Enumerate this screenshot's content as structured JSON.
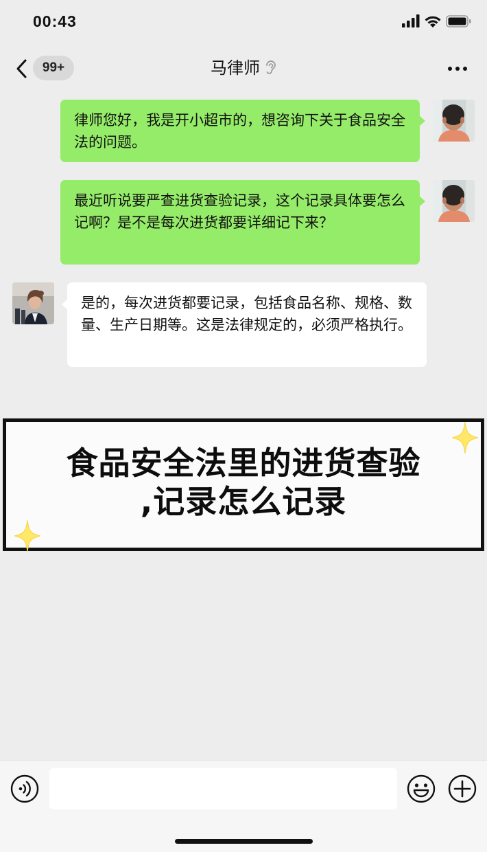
{
  "status_bar": {
    "time": "00:43",
    "icons": [
      "cellular-signal-icon",
      "wifi-icon",
      "battery-icon"
    ]
  },
  "nav": {
    "back_icon": "chevron-left-icon",
    "unread_badge": "99+",
    "title": "马律师",
    "title_icon": "ear-icon",
    "more_icon": "more-dots-icon"
  },
  "messages": [
    {
      "sender": "self",
      "text": "律师您好，我是开小超市的，想咨询下关于食品安全法的问题。",
      "bubble_color": "#95ec69",
      "avatar": "user-avatar"
    },
    {
      "sender": "self",
      "text": "最近听说要严查进货查验记录，这个记录具体要怎么记啊？是不是每次进货都要详细记下来？",
      "bubble_color": "#95ec69",
      "avatar": "user-avatar"
    },
    {
      "sender": "lawyer",
      "text": "是的，每次进货都要记录，包括食品名称、规格、数量、生产日期等。这是法律规定的，必须严格执行。",
      "bubble_color": "#ffffff",
      "avatar": "lawyer-avatar"
    }
  ],
  "banner": {
    "line1": "食品安全法里的进货查验",
    "line2": ",记录怎么记录",
    "border_color": "#111111",
    "sparkle_color": "#ffe768"
  },
  "input_bar": {
    "voice_icon": "voice-input-icon",
    "input_value": "",
    "emoji_icon": "emoji-icon",
    "plus_icon": "plus-icon"
  },
  "colors": {
    "background": "#ededed",
    "self_bubble": "#95ec69",
    "other_bubble": "#ffffff"
  }
}
